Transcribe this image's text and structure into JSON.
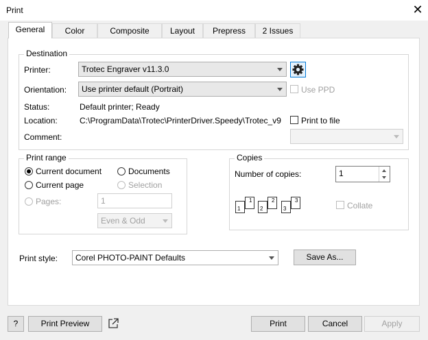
{
  "window": {
    "title": "Print",
    "close_glyph": "✕"
  },
  "tabs": [
    "General",
    "Color",
    "Composite",
    "Layout",
    "Prepress",
    "2 Issues"
  ],
  "destination": {
    "title": "Destination",
    "printer_label": "Printer:",
    "printer_value": "Trotec Engraver v11.3.0",
    "orientation_label": "Orientation:",
    "orientation_value": "Use printer default (Portrait)",
    "use_ppd_label": "Use PPD",
    "status_label": "Status:",
    "status_value": "Default printer; Ready",
    "location_label": "Location:",
    "location_value": "C:\\ProgramData\\Trotec\\PrinterDriver.Speedy\\Trotec_v9",
    "print_to_file_label": "Print to file",
    "comment_label": "Comment:"
  },
  "print_range": {
    "title": "Print range",
    "current_document": "Current document",
    "documents": "Documents",
    "current_page": "Current page",
    "selection": "Selection",
    "pages_label": "Pages:",
    "pages_value": "1",
    "page_filter": "Even & Odd"
  },
  "copies": {
    "title": "Copies",
    "number_label": "Number of copies:",
    "number_value": "1",
    "collate_label": "Collate",
    "collate_pages": [
      "1",
      "1",
      "2",
      "2",
      "3",
      "3"
    ]
  },
  "print_style": {
    "label": "Print style:",
    "value": "Corel PHOTO-PAINT Defaults",
    "save_as": "Save As..."
  },
  "footer": {
    "help": "?",
    "preview": "Print Preview",
    "print": "Print",
    "cancel": "Cancel",
    "apply": "Apply"
  },
  "colors": {
    "accent": "#0078d7",
    "disabled_text": "#a0a0a0"
  }
}
